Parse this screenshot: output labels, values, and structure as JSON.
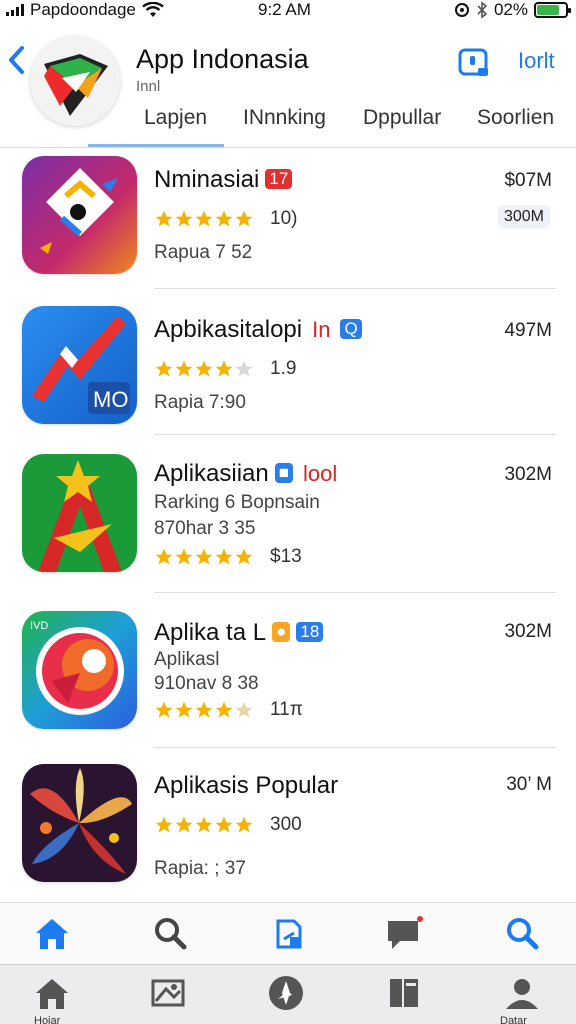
{
  "status_bar": {
    "carrier": "Papdoondage",
    "time": "9:2 AM",
    "battery": "02%"
  },
  "header": {
    "title": "App Indonasia",
    "subtitle": "Innl",
    "right_link": "Iorlt",
    "tabs": [
      "Lapjen",
      "INnnking",
      "Dppullar",
      "Soorlien"
    ]
  },
  "apps": [
    {
      "name": "Nminasiai",
      "badge": "17",
      "size": "$07M",
      "size_pill": "300M",
      "rating_value": "10)",
      "stars": 5,
      "meta": [
        "Rapua 7 52"
      ]
    },
    {
      "name": "Apbikasitalopi",
      "badge_text": "In",
      "badge": "Q",
      "size": "497M",
      "rating_value": "1.9",
      "stars": 4,
      "meta": [
        "Rapia 7:90"
      ],
      "icon_label": "MO"
    },
    {
      "name": "Aplikasiian",
      "badge": "■",
      "badge_text": "lool",
      "size": "302M",
      "rating_value": "$13",
      "stars": 5,
      "meta": [
        "Rarking 6 Bopnsain",
        "870har 3 35"
      ]
    },
    {
      "name": "Aplika ta L",
      "badge": "18",
      "size": "302M",
      "rating_value": "11π",
      "stars": 4,
      "meta": [
        "Aplikasl",
        "910nav 8 38"
      ],
      "icon_label": "IVD"
    },
    {
      "name": "Aplikasis Popular",
      "size": "30’ M",
      "rating_value": "300",
      "stars": 5,
      "meta": [
        "Rapia: ; 37"
      ]
    }
  ],
  "bottom_bar_1": {
    "items": [
      "home-icon",
      "search-icon",
      "share-icon",
      "chat-icon",
      "search-icon"
    ]
  },
  "bottom_bar_2": {
    "items": [
      "home-icon",
      "photo-icon",
      "compass-icon",
      "book-icon",
      "profile-icon"
    ],
    "labels": [
      "Hoiar",
      "",
      "",
      "",
      "Datar"
    ]
  },
  "colors": {
    "accent": "#1d7bf2",
    "star": "#f5b300",
    "badge_red": "#e03030",
    "badge_blue": "#2b7de9"
  }
}
